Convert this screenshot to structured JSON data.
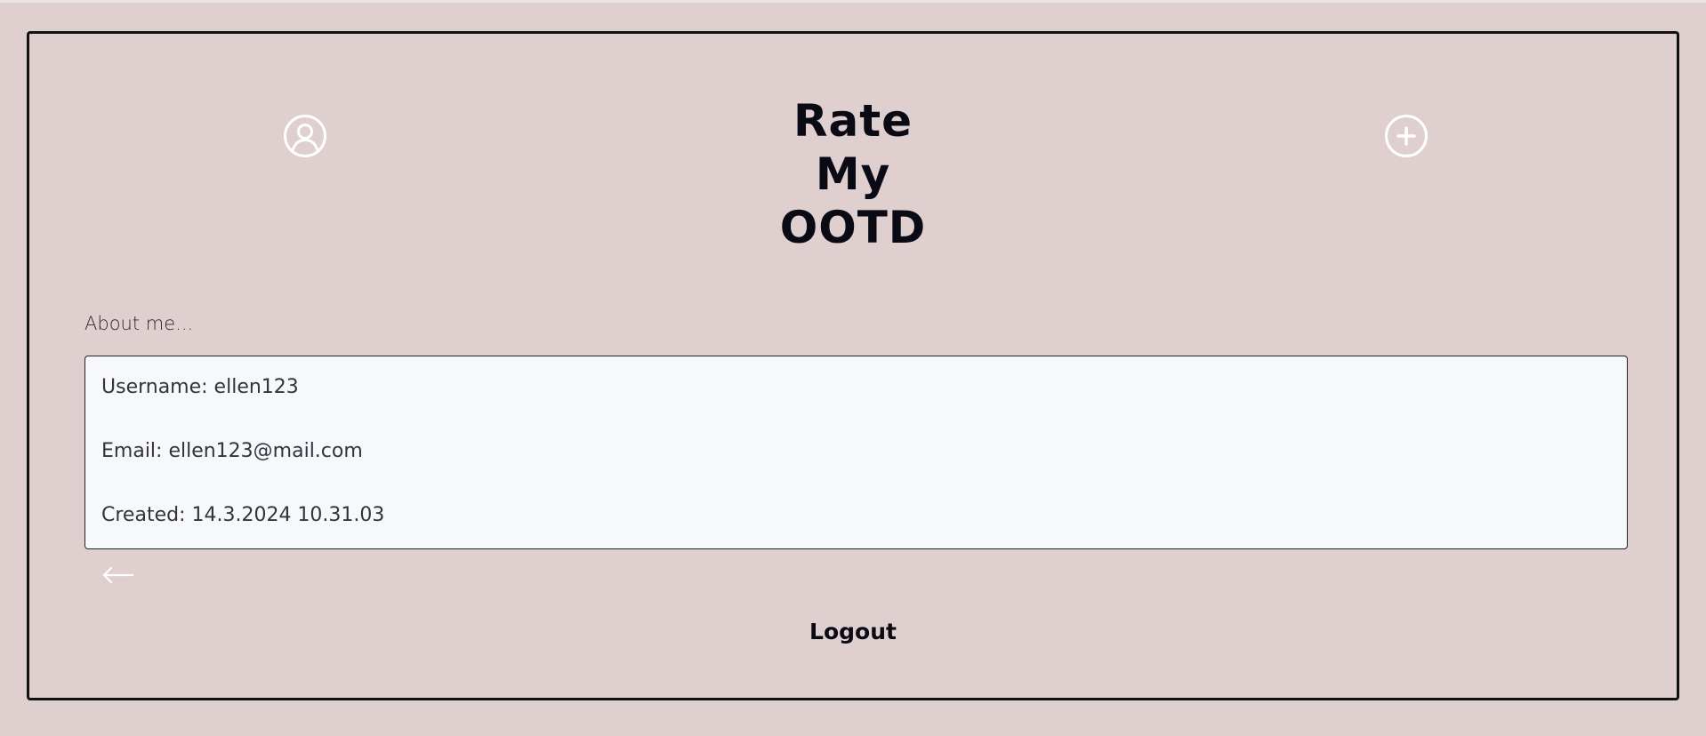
{
  "header": {
    "logo_lines": [
      "Rate",
      "My",
      "OOTD"
    ],
    "profile_icon": "user-circle-icon",
    "add_icon": "plus-circle-icon"
  },
  "profile": {
    "section_label": "About me...",
    "username": "Username: ellen123",
    "email": "Email: ellen123@mail.com",
    "created": "Created: 14.3.2024 10.31.03"
  },
  "footer": {
    "back_icon": "arrow-left-icon",
    "logout_label": "Logout"
  },
  "colors": {
    "background": "#e0cfcf",
    "frame_border": "#111111",
    "box_background": "#f7f8fb",
    "icon_color": "#ffffff",
    "text_dark": "#0a0a14"
  }
}
